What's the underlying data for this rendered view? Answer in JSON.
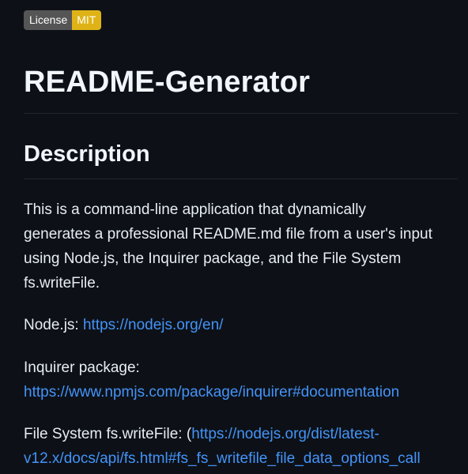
{
  "badge": {
    "label": "License",
    "value": "MIT"
  },
  "title": "README-Generator",
  "description": {
    "heading": "Description",
    "text": "This is a command-line application that dynamically generates a professional README.md file from a user's input using Node.js, the Inquirer package, and the File System fs.writeFile.",
    "node": {
      "label": "Node.js: ",
      "url": "https://nodejs.org/en/"
    },
    "inquirer": {
      "label": "Inquirer package:",
      "url": "https://www.npmjs.com/package/inquirer#documentation"
    },
    "fs": {
      "label": "File System fs.writeFile: (",
      "url_line1": "https://nodejs.org/dist/latest-",
      "url_line2": "v12.x/docs/api/fs.html#fs_fs_writefile_file_data_options_call"
    }
  },
  "colors": {
    "background": "#0d1117",
    "text": "#e6edf3",
    "link": "#4493f8",
    "badge_left": "#555555",
    "badge_right": "#dfb317"
  }
}
